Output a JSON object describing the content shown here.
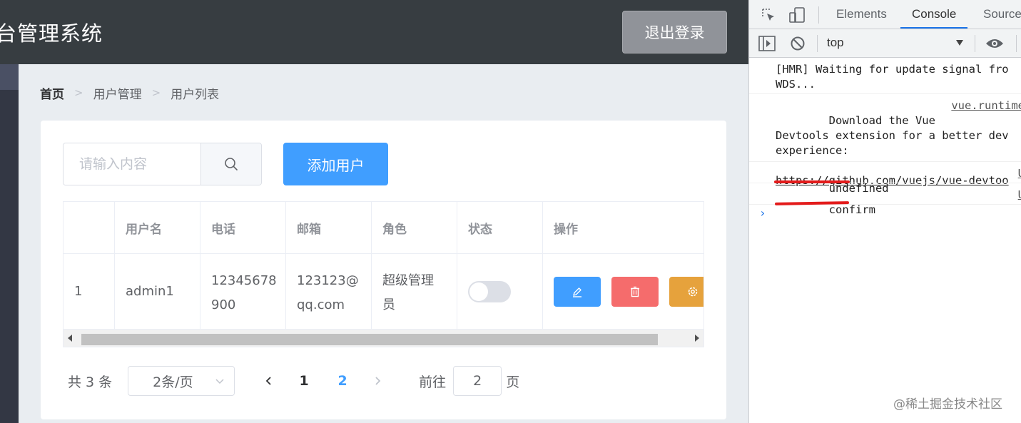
{
  "app": {
    "title": "台管理系统",
    "logout_label": "退出登录",
    "breadcrumb": {
      "home": "首页",
      "level1": "用户管理",
      "level2": "用户列表",
      "separator": ">"
    },
    "search": {
      "placeholder": "请输入内容",
      "value": ""
    },
    "add_user_label": "添加用户",
    "table": {
      "columns": [
        "",
        "用户名",
        "电话",
        "邮箱",
        "角色",
        "状态",
        "操作"
      ],
      "rows": [
        {
          "index": "1",
          "username": "admin1",
          "phone_line1": "12345678",
          "phone_line2": "900",
          "email_line1": "123123@",
          "email_line2": "qq.com",
          "role_line1": "超级管理",
          "role_line2": "员",
          "status_on": false
        }
      ],
      "actions": {
        "edit_color": "#409eff",
        "delete_color": "#f56c6c",
        "settings_color": "#e6a23c"
      }
    },
    "pagination": {
      "total": "共 3 条",
      "page_size": "2条/页",
      "pages": [
        "1",
        "2"
      ],
      "current_page": "2",
      "goto_label": "前往",
      "goto_value": "2",
      "page_suffix": "页"
    }
  },
  "devtools": {
    "tabs": {
      "elements": "Elements",
      "console": "Console",
      "sources": "Source"
    },
    "context": "top",
    "messages": {
      "m1": "[HMR] Waiting for update signal fro\nWDS...",
      "m2_text": "Download the Vue\nDevtools extension for a better dev\nexperience:",
      "m2_src": "vue.runtime",
      "m2_link": "https://github.com/vuejs/vue-devtoo",
      "m3": "undefined",
      "m3_src": "U",
      "m4": "confirm",
      "m4_src": "U"
    },
    "prompt": "›"
  },
  "watermark": "@稀土掘金技术社区",
  "colors": {
    "header": "#373d41",
    "primary": "#409eff",
    "devtools_accent": "#1a73e8",
    "annotation": "#e31b1b"
  }
}
